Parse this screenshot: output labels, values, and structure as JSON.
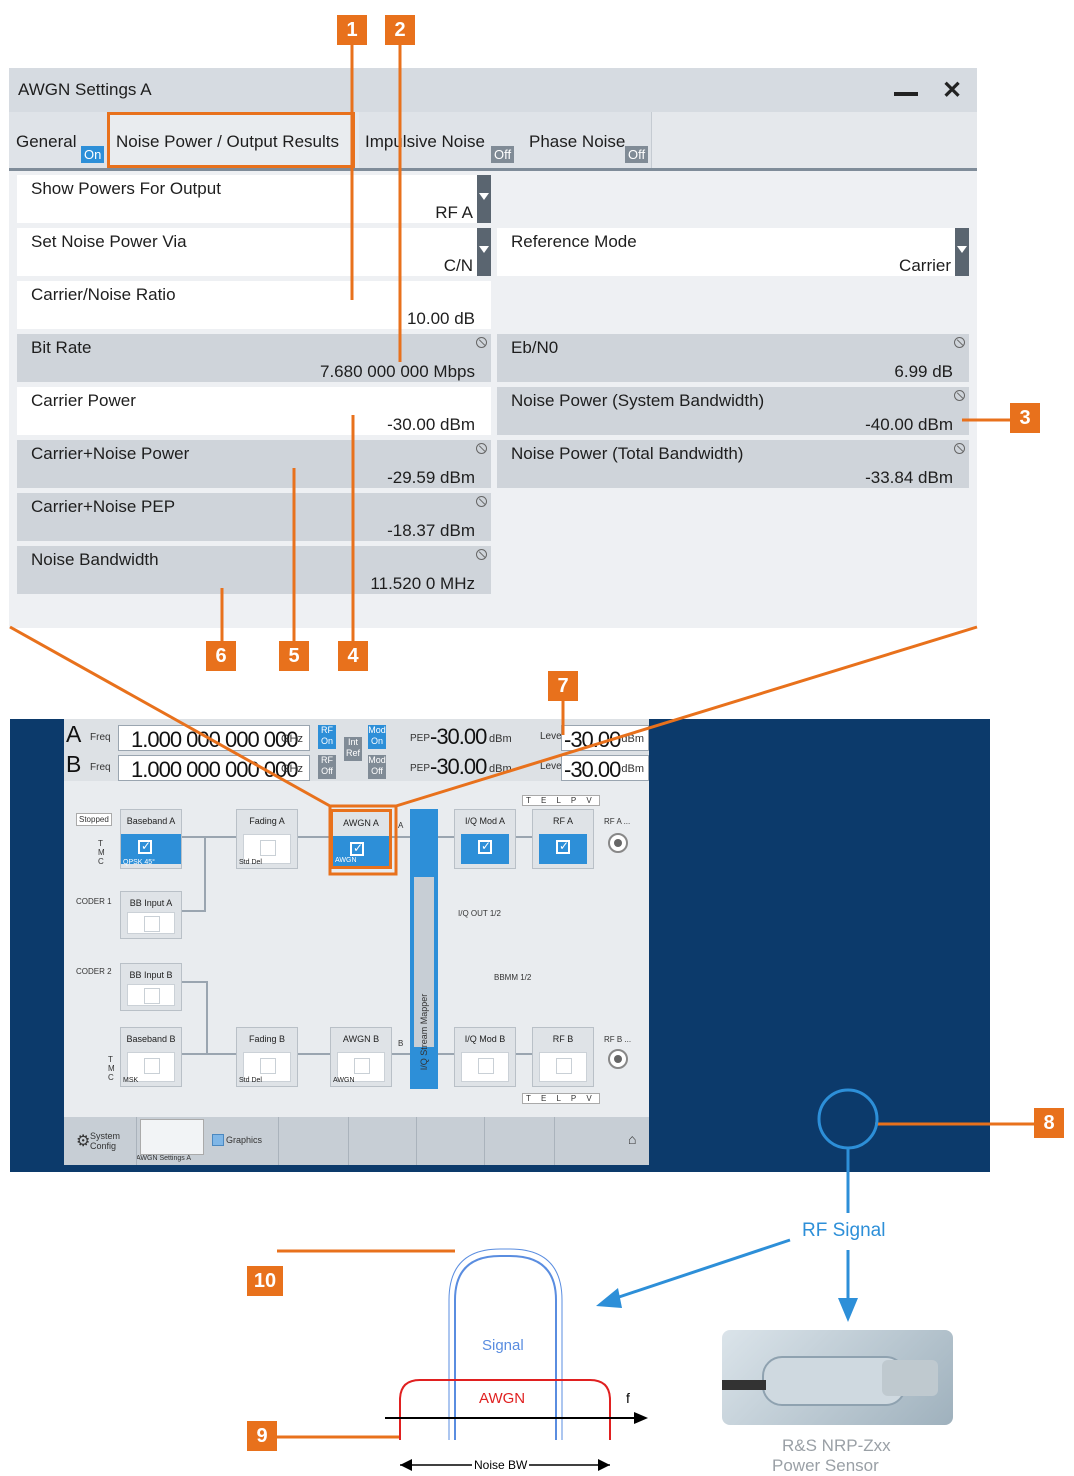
{
  "callouts": [
    "1",
    "2",
    "3",
    "4",
    "5",
    "6",
    "7",
    "8",
    "9",
    "10"
  ],
  "dialog": {
    "title": "AWGN Settings A",
    "tabs": [
      {
        "label": "General",
        "state": "On"
      },
      {
        "label": "Noise Power / Output Results",
        "state": ""
      },
      {
        "label": "Impulsive Noise",
        "state": "Off"
      },
      {
        "label": "Phase Noise",
        "state": "Off"
      }
    ],
    "left_fields": [
      {
        "label": "Show Powers For Output",
        "value": "RF A"
      },
      {
        "label": "Set Noise Power Via",
        "value": "C/N"
      },
      {
        "label": "Carrier/Noise Ratio",
        "value": "10.00 dB"
      },
      {
        "label": "Bit Rate",
        "value": "7.680 000 000 Mbps"
      },
      {
        "label": "Carrier Power",
        "value": "-30.00 dBm"
      },
      {
        "label": "Carrier+Noise Power",
        "value": "-29.59 dBm"
      },
      {
        "label": "Carrier+Noise PEP",
        "value": "-18.37 dBm"
      },
      {
        "label": "Noise Bandwidth",
        "value": "11.520 0 MHz"
      }
    ],
    "right_fields": [
      {
        "label": "Reference Mode",
        "value": "Carrier"
      },
      {
        "label": "Eb/N0",
        "value": "6.99 dB"
      },
      {
        "label": "Noise Power (System Bandwidth)",
        "value": "-40.00 dBm"
      },
      {
        "label": "Noise Power (Total Bandwidth)",
        "value": "-33.84 dBm"
      }
    ]
  },
  "instrument": {
    "path_a": {
      "letter": "A",
      "freq_label": "Freq",
      "freq": "1.000 000 000 000",
      "freq_unit": "GHz",
      "rf": "RF\nOn",
      "mod": "Mod\nOn",
      "pep_label": "PEP",
      "pep": "-30.00",
      "pep_unit": "dBm",
      "level_label": "Level",
      "level": "-30.00",
      "level_unit": "dBm"
    },
    "path_b": {
      "letter": "B",
      "freq_label": "Freq",
      "freq": "1.000 000 000 000",
      "freq_unit": "GHz",
      "rf": "RF\nOff",
      "mod": "Mod\nOff",
      "pep_label": "PEP",
      "pep": "-30.00",
      "pep_unit": "dBm",
      "level_label": "Level",
      "level": "-30.00",
      "level_unit": "dBm"
    },
    "int_ref": "Int\nRef",
    "stopped": "Stopped",
    "tmc": "T\nM\nC",
    "blocks": {
      "baseband_a": {
        "title": "Baseband A",
        "sub": "QPSK 45°"
      },
      "fading_a": {
        "title": "Fading A",
        "sub": "Std Del"
      },
      "awgn_a": {
        "title": "AWGN A",
        "sub": "AWGN"
      },
      "iqmod_a": {
        "title": "I/Q Mod A",
        "sub": ""
      },
      "rf_a": {
        "title": "RF A",
        "sub": ""
      },
      "bbinput_a": {
        "title": "BB Input A",
        "sub": ""
      },
      "bbinput_b": {
        "title": "BB Input B",
        "sub": ""
      },
      "baseband_b": {
        "title": "Baseband B",
        "sub": "MSK"
      },
      "fading_b": {
        "title": "Fading B",
        "sub": "Std Del"
      },
      "awgn_b": {
        "title": "AWGN B",
        "sub": "AWGN"
      },
      "iqmod_b": {
        "title": "I/Q Mod B",
        "sub": ""
      },
      "rf_b": {
        "title": "RF B",
        "sub": ""
      }
    },
    "coder1": "CODER 1",
    "coder2": "CODER 2",
    "mapper": "I/Q Stream Mapper",
    "iq_out": "I/Q OUT 1/2",
    "bbmm": "BBMM 1/2",
    "telpv_top": "T E L P V",
    "telpv_bottom": "T E L P V",
    "rf_a_conn": "RF A ...",
    "rf_b_conn": "RF B ...",
    "label_a": "A",
    "label_b": "B",
    "taskbar": {
      "system_config": "System\nConfig",
      "awgn_settings": "AWGN Settings A",
      "graphics": "Graphics"
    }
  },
  "diagram": {
    "rf_signal": "RF Signal",
    "signal": "Signal",
    "awgn": "AWGN",
    "f": "f",
    "noise_bw": "Noise BW",
    "sensor_line1": "R&S NRP-Zxx",
    "sensor_line2": "Power Sensor"
  },
  "colors": {
    "accent": "#e8711c",
    "blue": "#2d8fd8",
    "navy": "#0c3a6b",
    "signal": "#5a8de0",
    "awgn": "#e02020"
  }
}
